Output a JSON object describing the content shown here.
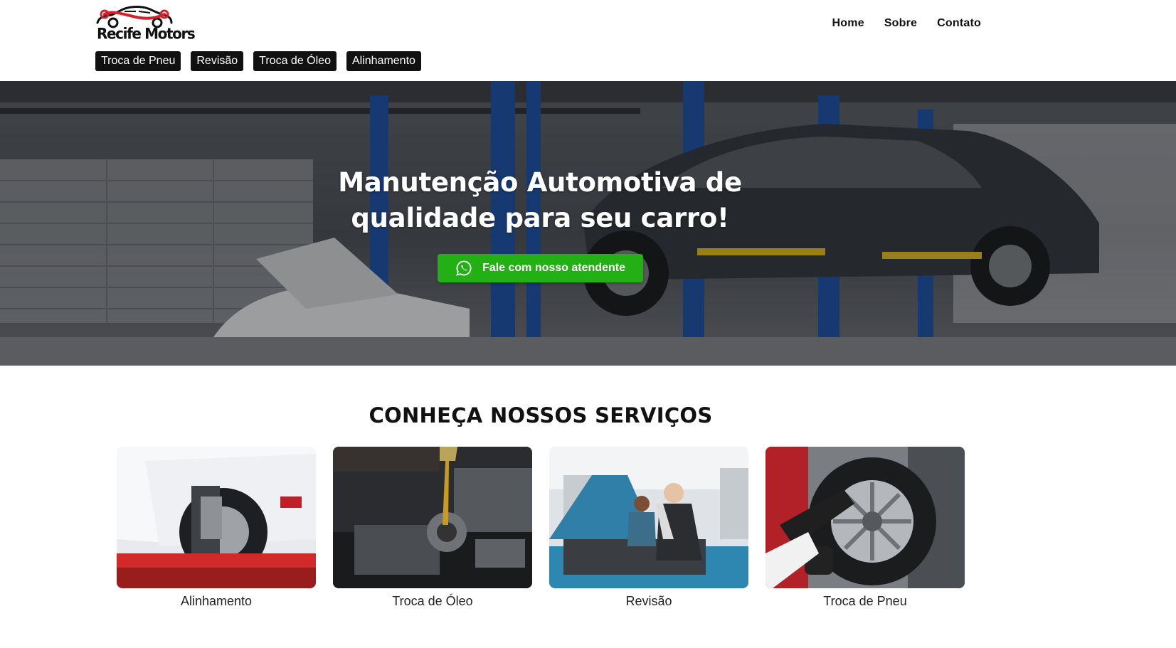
{
  "brand": {
    "name": "Recife Motors"
  },
  "nav": {
    "home": "Home",
    "about": "Sobre",
    "contact": "Contato"
  },
  "service_tags": [
    {
      "label": "Troca de Pneu"
    },
    {
      "label": "Revisão"
    },
    {
      "label": "Troca de Óleo"
    },
    {
      "label": "Alinhamento"
    }
  ],
  "hero": {
    "title_line1": "Manutenção Automotiva de",
    "title_line2": "qualidade para seu carro!",
    "cta_label": "Fale com nosso atendente",
    "cta_icon": "whatsapp-icon"
  },
  "services": {
    "title": "CONHEÇA NOSSOS SERVIÇOS",
    "cards": [
      {
        "label": "Alinhamento"
      },
      {
        "label": "Troca de Óleo"
      },
      {
        "label": "Revisão"
      },
      {
        "label": "Troca de Pneu"
      }
    ]
  },
  "colors": {
    "cta": "#22b014",
    "tag_bg": "#111111",
    "logo_red": "#d8202a"
  }
}
